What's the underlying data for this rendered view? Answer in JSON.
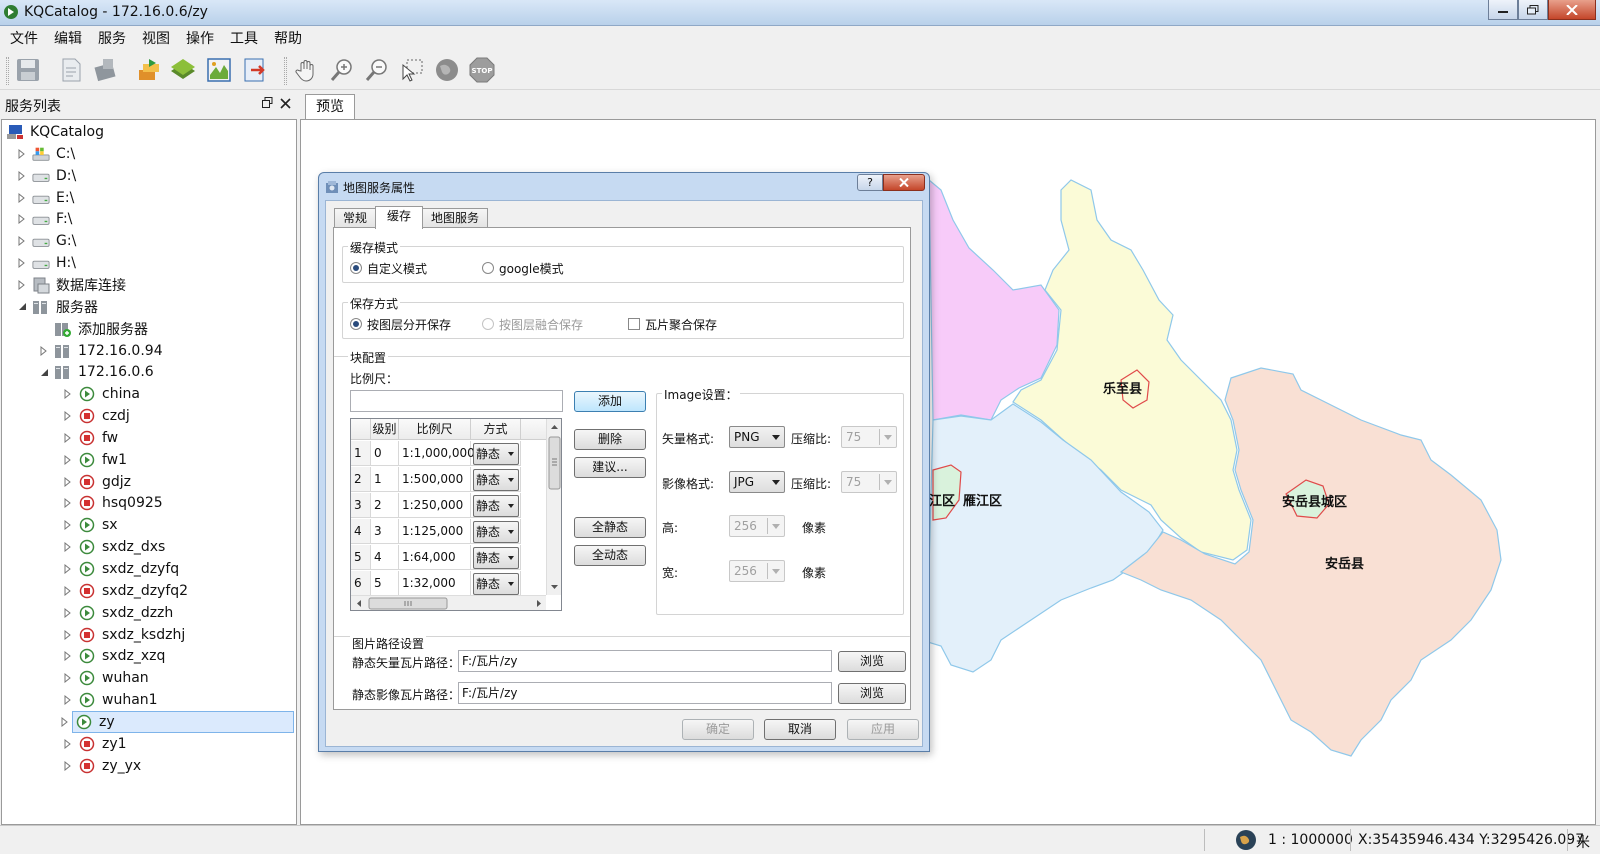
{
  "window": {
    "title": "KQCatalog - 172.16.0.6/zy"
  },
  "menu": [
    "文件",
    "编辑",
    "服务",
    "视图",
    "操作",
    "工具",
    "帮助"
  ],
  "left_panel": {
    "title": "服务列表",
    "tree": {
      "root": "KQCatalog",
      "drives": [
        "C:\\",
        "D:\\",
        "E:\\",
        "F:\\",
        "G:\\",
        "H:\\"
      ],
      "db": "数据库连接",
      "servers": "服务器",
      "add_server": "添加服务器",
      "server1": "172.16.0.94",
      "server2": "172.16.0.6",
      "services": [
        {
          "name": "china",
          "status": "running"
        },
        {
          "name": "czdj",
          "status": "stopped"
        },
        {
          "name": "fw",
          "status": "stopped"
        },
        {
          "name": "fw1",
          "status": "running"
        },
        {
          "name": "gdjz",
          "status": "stopped"
        },
        {
          "name": "hsq0925",
          "status": "stopped"
        },
        {
          "name": "sx",
          "status": "running"
        },
        {
          "name": "sxdz_dxs",
          "status": "running"
        },
        {
          "name": "sxdz_dzyfq",
          "status": "running"
        },
        {
          "name": "sxdz_dzyfq2",
          "status": "stopped"
        },
        {
          "name": "sxdz_dzzh",
          "status": "running"
        },
        {
          "name": "sxdz_ksdzhj",
          "status": "stopped"
        },
        {
          "name": "sxdz_xzq",
          "status": "running"
        },
        {
          "name": "wuhan",
          "status": "running"
        },
        {
          "name": "wuhan1",
          "status": "running"
        },
        {
          "name": "zy",
          "status": "running"
        },
        {
          "name": "zy1",
          "status": "stopped"
        },
        {
          "name": "zy_yx",
          "status": "stopped"
        }
      ],
      "selected": "zy"
    }
  },
  "preview_tab": "预览",
  "map": {
    "labels": {
      "lezhi": "乐至县",
      "anyue_city": "安岳县城区",
      "anyue": "安岳县",
      "yanjiang": "雁江区",
      "jiang": "江区"
    },
    "colors": {
      "magenta": "#f7cbf9",
      "yellow": "#fbfbd7",
      "blue": "#e3f0fa",
      "peach": "#f9e0d4",
      "green": "#d9f2dc",
      "border": "#8fc8ea",
      "city_border": "#e04a4a"
    }
  },
  "status": {
    "scale": "1 : 1000000",
    "coords": "X:35435946.434 Y:3295426.097",
    "unit": "米"
  },
  "dialog": {
    "title": "地图服务属性",
    "help": "?",
    "tabs": [
      "常规",
      "缓存",
      "地图服务"
    ],
    "cache_mode": {
      "legend": "缓存模式",
      "custom": "自定义模式",
      "google": "google模式"
    },
    "save_mode": {
      "legend": "保存方式",
      "by_layer": "按图层分开保存",
      "merged": "按图层融合保存",
      "tile_aggregate": "瓦片聚合保存"
    },
    "block": {
      "legend": "块配置",
      "scale_label": "比例尺：",
      "columns": [
        "级别",
        "比例尺",
        "方式"
      ],
      "rows": [
        {
          "n": "1",
          "level": "0",
          "scale": "1:1,000,000",
          "mode": "静态"
        },
        {
          "n": "2",
          "level": "1",
          "scale": "1:500,000",
          "mode": "静态"
        },
        {
          "n": "3",
          "level": "2",
          "scale": "1:250,000",
          "mode": "静态"
        },
        {
          "n": "4",
          "level": "3",
          "scale": "1:125,000",
          "mode": "静态"
        },
        {
          "n": "5",
          "level": "4",
          "scale": "1:64,000",
          "mode": "静态"
        },
        {
          "n": "6",
          "level": "5",
          "scale": "1:32,000",
          "mode": "静态"
        }
      ],
      "add": "添加",
      "delete": "删除",
      "suggest": "建议...",
      "all_static": "全静态",
      "all_dynamic": "全动态"
    },
    "image": {
      "legend": "Image设置：",
      "vector_format_label": "矢量格式:",
      "vector_format": "PNG",
      "ratio_label": "压缩比:",
      "vector_ratio": "75",
      "image_format_label": "影像格式:",
      "image_format": "JPG",
      "image_ratio": "75",
      "height_label": "高:",
      "height": "256",
      "width_label": "宽:",
      "width": "256",
      "pixel": "像素"
    },
    "path": {
      "legend": "图片路径设置",
      "vector_label": "静态矢量瓦片路径：",
      "vector_path": "F:/瓦片/zy",
      "image_label": "静态影像瓦片路径：",
      "image_path": "F:/瓦片/zy",
      "browse": "浏览"
    },
    "ok": "确定",
    "cancel": "取消",
    "apply": "应用"
  }
}
